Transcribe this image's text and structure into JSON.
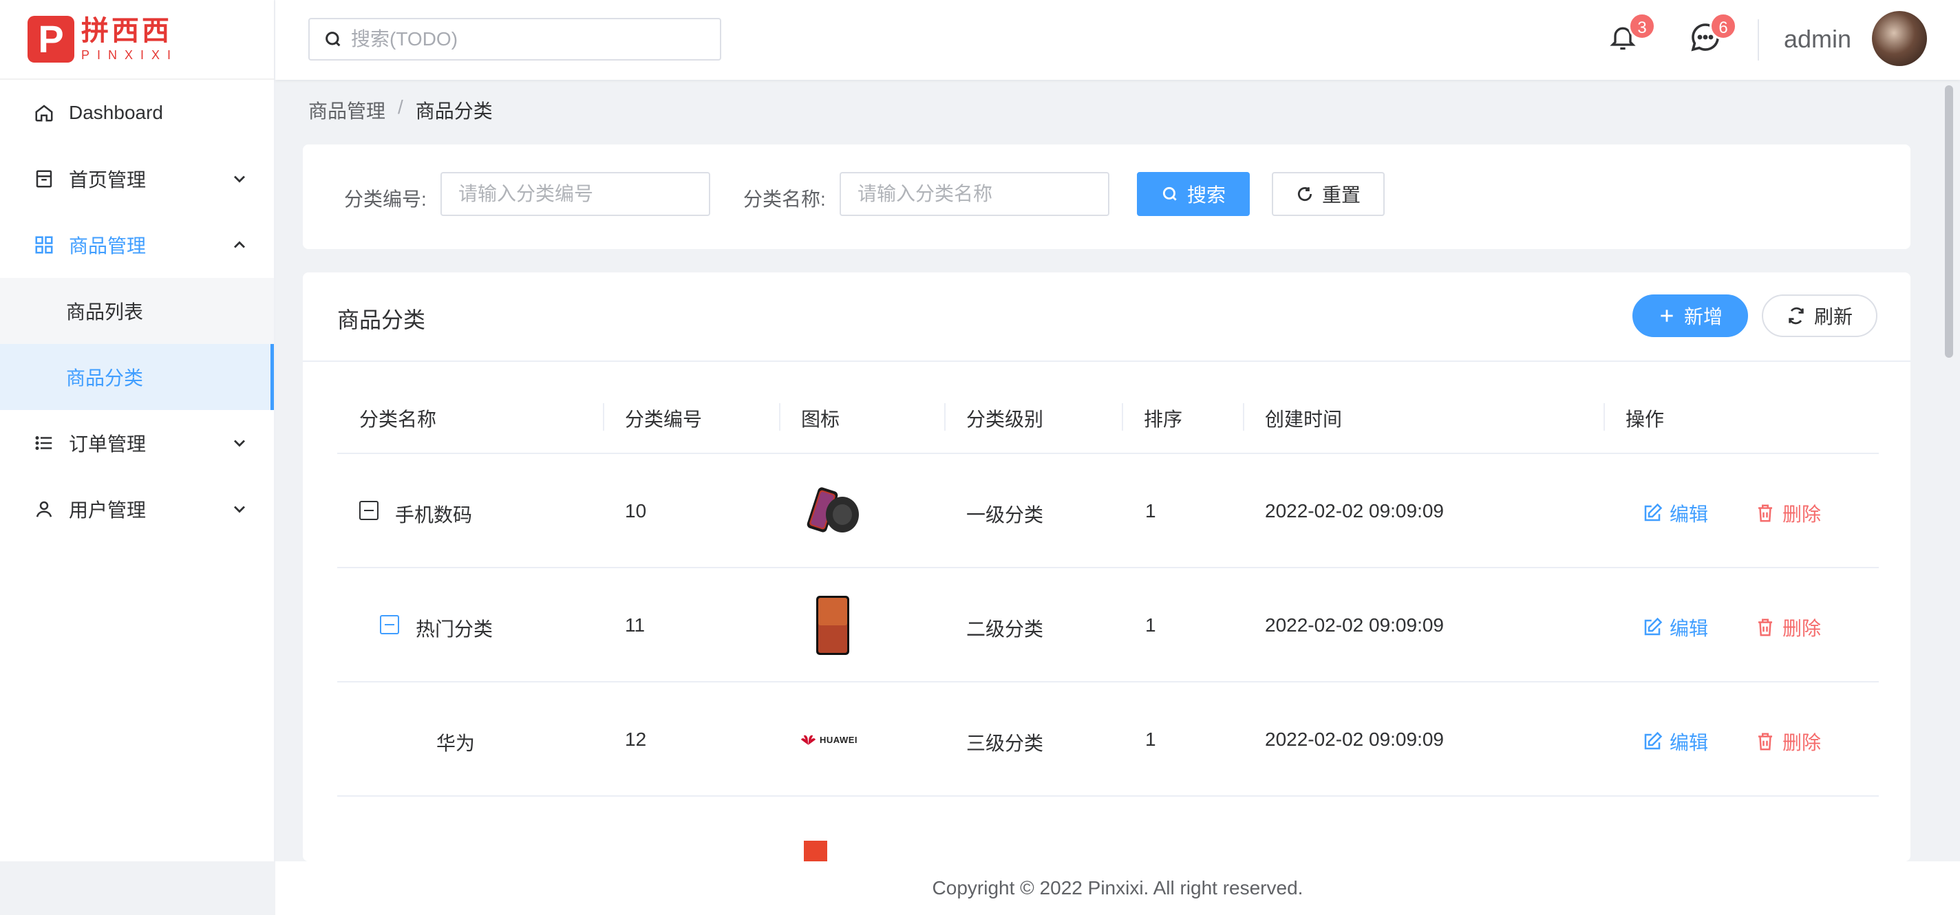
{
  "brand": {
    "logo_letter": "P",
    "name_cn": "拼西西",
    "name_en": "PINXIXI",
    "color": "#e53935"
  },
  "header": {
    "search_placeholder": "搜索(TODO)",
    "notifications_count": "3",
    "messages_count": "6",
    "username": "admin"
  },
  "sidebar": {
    "items": [
      {
        "label": "Dashboard",
        "icon": "home-icon"
      },
      {
        "label": "首页管理",
        "icon": "layout-icon"
      },
      {
        "label": "商品管理",
        "icon": "grid-icon"
      },
      {
        "label": "订单管理",
        "icon": "list-icon"
      },
      {
        "label": "用户管理",
        "icon": "user-icon"
      }
    ],
    "submenu": [
      {
        "label": "商品列表"
      },
      {
        "label": "商品分类"
      }
    ]
  },
  "breadcrumb": {
    "parent": "商品管理",
    "separator": "/",
    "current": "商品分类"
  },
  "filter": {
    "code_label": "分类编号:",
    "code_placeholder": "请输入分类编号",
    "name_label": "分类名称:",
    "name_placeholder": "请输入分类名称",
    "search_label": "搜索",
    "reset_label": "重置"
  },
  "table_card": {
    "title": "商品分类",
    "add_label": "新增",
    "refresh_label": "刷新",
    "columns": [
      "分类名称",
      "分类编号",
      "图标",
      "分类级别",
      "排序",
      "创建时间",
      "操作"
    ],
    "rows": [
      {
        "name": "手机数码",
        "code": "10",
        "icon": "phone-charger-image",
        "level": "一级分类",
        "sort": "1",
        "created": "2022-02-02 09:09:09",
        "edit": "编辑",
        "delete": "删除"
      },
      {
        "name": "热门分类",
        "code": "11",
        "icon": "smartphone-image",
        "level": "二级分类",
        "sort": "1",
        "created": "2022-02-02 09:09:09",
        "edit": "编辑",
        "delete": "删除"
      },
      {
        "name": "华为",
        "code": "12",
        "icon": "huawei-logo",
        "level": "三级分类",
        "sort": "1",
        "created": "2022-02-02 09:09:09",
        "edit": "编辑",
        "delete": "删除"
      }
    ],
    "huawei_logo_text": "HUAWEI"
  },
  "footer": {
    "copyright": "Copyright © 2022 Pinxixi. All right reserved."
  },
  "colors": {
    "primary": "#409eff",
    "danger": "#f56c6c",
    "background": "#f0f2f5"
  }
}
